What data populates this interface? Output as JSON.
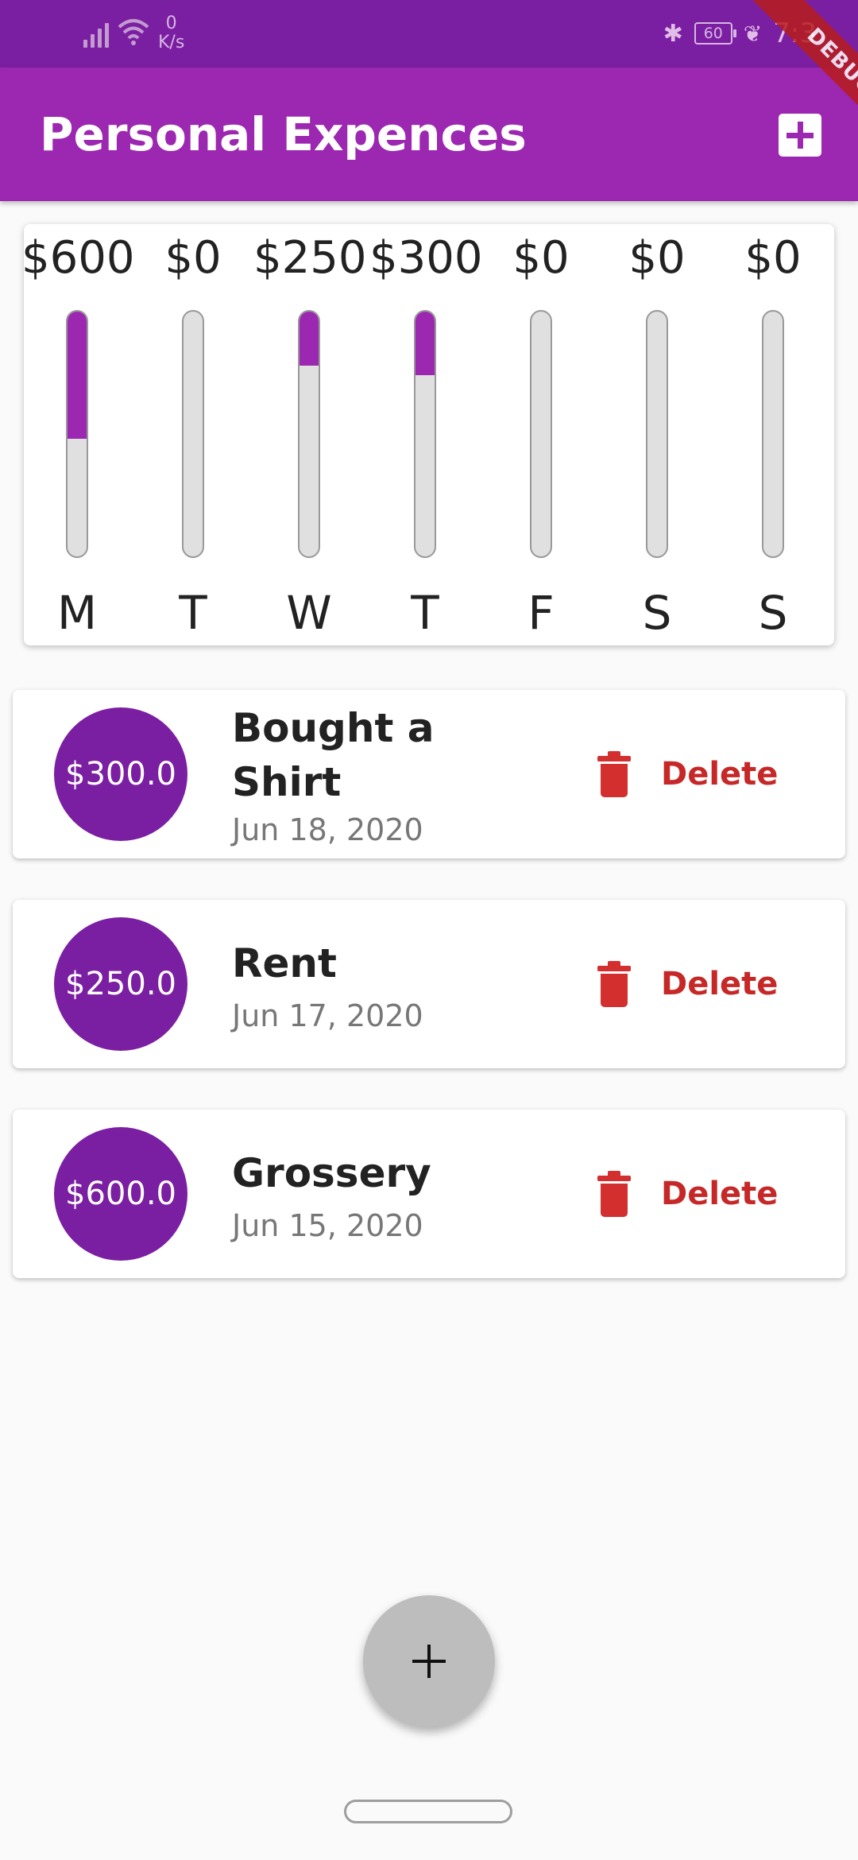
{
  "status_bar": {
    "net_speed_value": "0",
    "net_speed_unit": "K/s",
    "battery": "60",
    "time": "7:3"
  },
  "app_bar": {
    "title": "Personal Expences",
    "add_icon": "plus-square-icon",
    "debug_banner": "DEBUG"
  },
  "colors": {
    "primary": "#9c27b0",
    "primary_dark": "#7b1fa2",
    "delete": "#d32f2f",
    "bar_track": "#e0e0e0"
  },
  "chart": {
    "days": [
      {
        "day": "M",
        "amount": "$600",
        "fraction": 0.52
      },
      {
        "day": "T",
        "amount": "$0",
        "fraction": 0
      },
      {
        "day": "W",
        "amount": "$250",
        "fraction": 0.22
      },
      {
        "day": "T",
        "amount": "$300",
        "fraction": 0.26
      },
      {
        "day": "F",
        "amount": "$0",
        "fraction": 0
      },
      {
        "day": "S",
        "amount": "$0",
        "fraction": 0
      },
      {
        "day": "S",
        "amount": "$0",
        "fraction": 0
      }
    ]
  },
  "transactions": [
    {
      "amount": "$300.0",
      "title": "Bought a Shirt",
      "date": "Jun 18, 2020",
      "delete_label": "Delete",
      "icon": "trash-icon"
    },
    {
      "amount": "$250.0",
      "title": "Rent",
      "date": "Jun 17, 2020",
      "delete_label": "Delete",
      "icon": "trash-icon"
    },
    {
      "amount": "$600.0",
      "title": "Grossery",
      "date": "Jun 15, 2020",
      "delete_label": "Delete",
      "icon": "trash-icon"
    }
  ],
  "fab": {
    "icon": "plus-icon"
  }
}
